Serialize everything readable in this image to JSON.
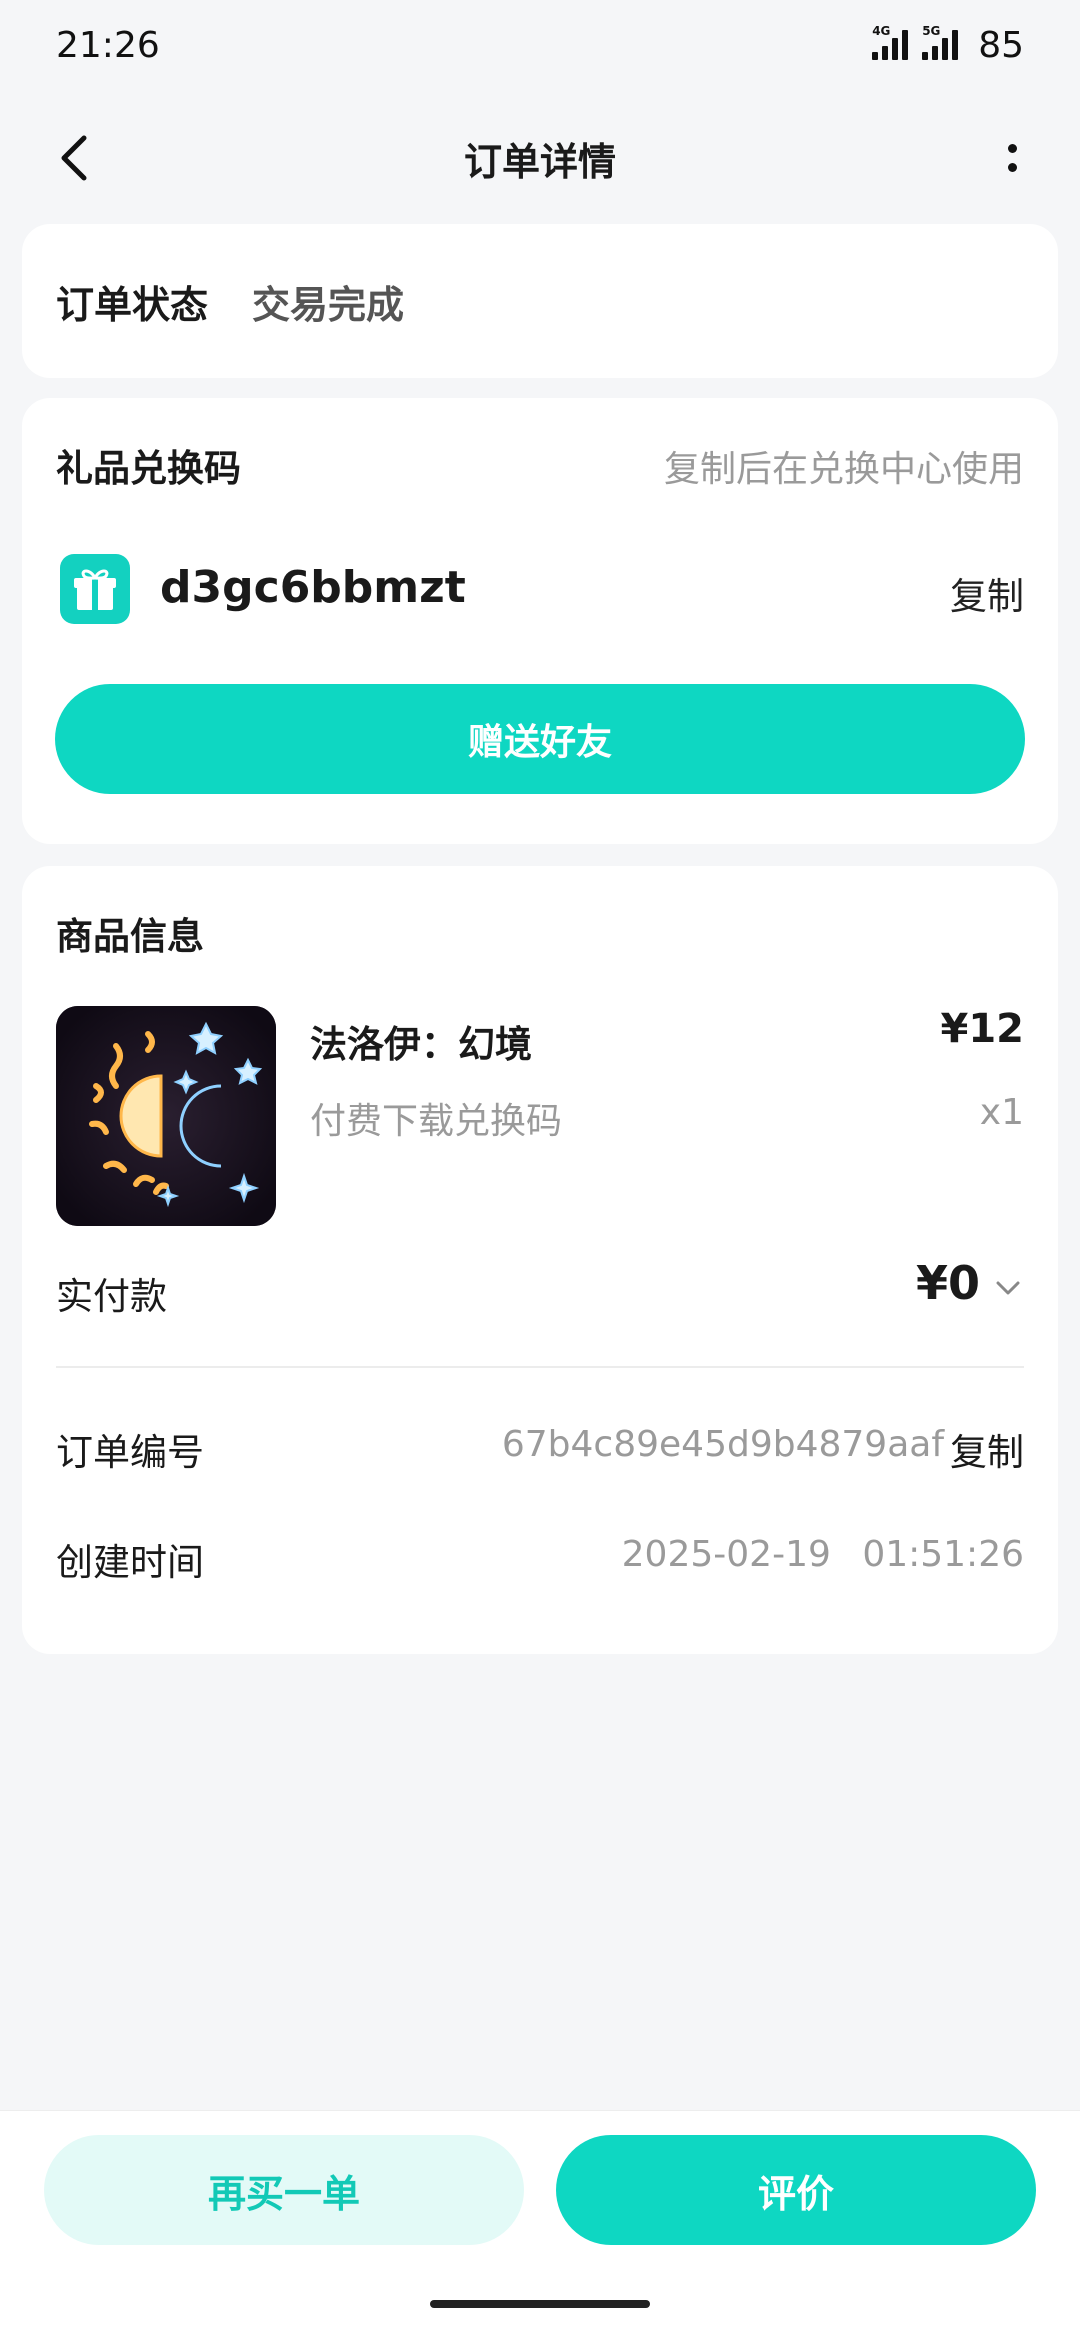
{
  "status_bar": {
    "time": "21:26",
    "network_1": "4G",
    "network_2": "5G",
    "battery": "85"
  },
  "nav": {
    "title": "订单详情",
    "back_icon": "chevron-left-icon",
    "more_icon": "more-vertical-icon"
  },
  "order_status": {
    "label": "订单状态",
    "value": "交易完成"
  },
  "gift": {
    "title": "礼品兑换码",
    "hint": "复制后在兑换中心使用",
    "icon": "gift-icon",
    "code": "d3gc6bbmzt",
    "copy_label": "复制",
    "send_label": "赠送好友"
  },
  "goods": {
    "title": "商品信息",
    "name": "法洛伊：幻境",
    "subtitle": "付费下载兑换码",
    "price": "¥12",
    "quantity": "x1",
    "paid_label": "实付款",
    "paid_value": "¥0",
    "order_no_label": "订单编号",
    "order_no_value": "67b4c89e45d9b4879aaf",
    "order_no_copy": "复制",
    "created_label": "创建时间",
    "created_value": "2025-02-19 01:51:26"
  },
  "actions": {
    "rebuy_label": "再买一单",
    "review_label": "评价"
  },
  "colors": {
    "accent": "#0ed7c2",
    "accent_light": "#e3faf7",
    "muted_text": "#9a9a9a"
  }
}
